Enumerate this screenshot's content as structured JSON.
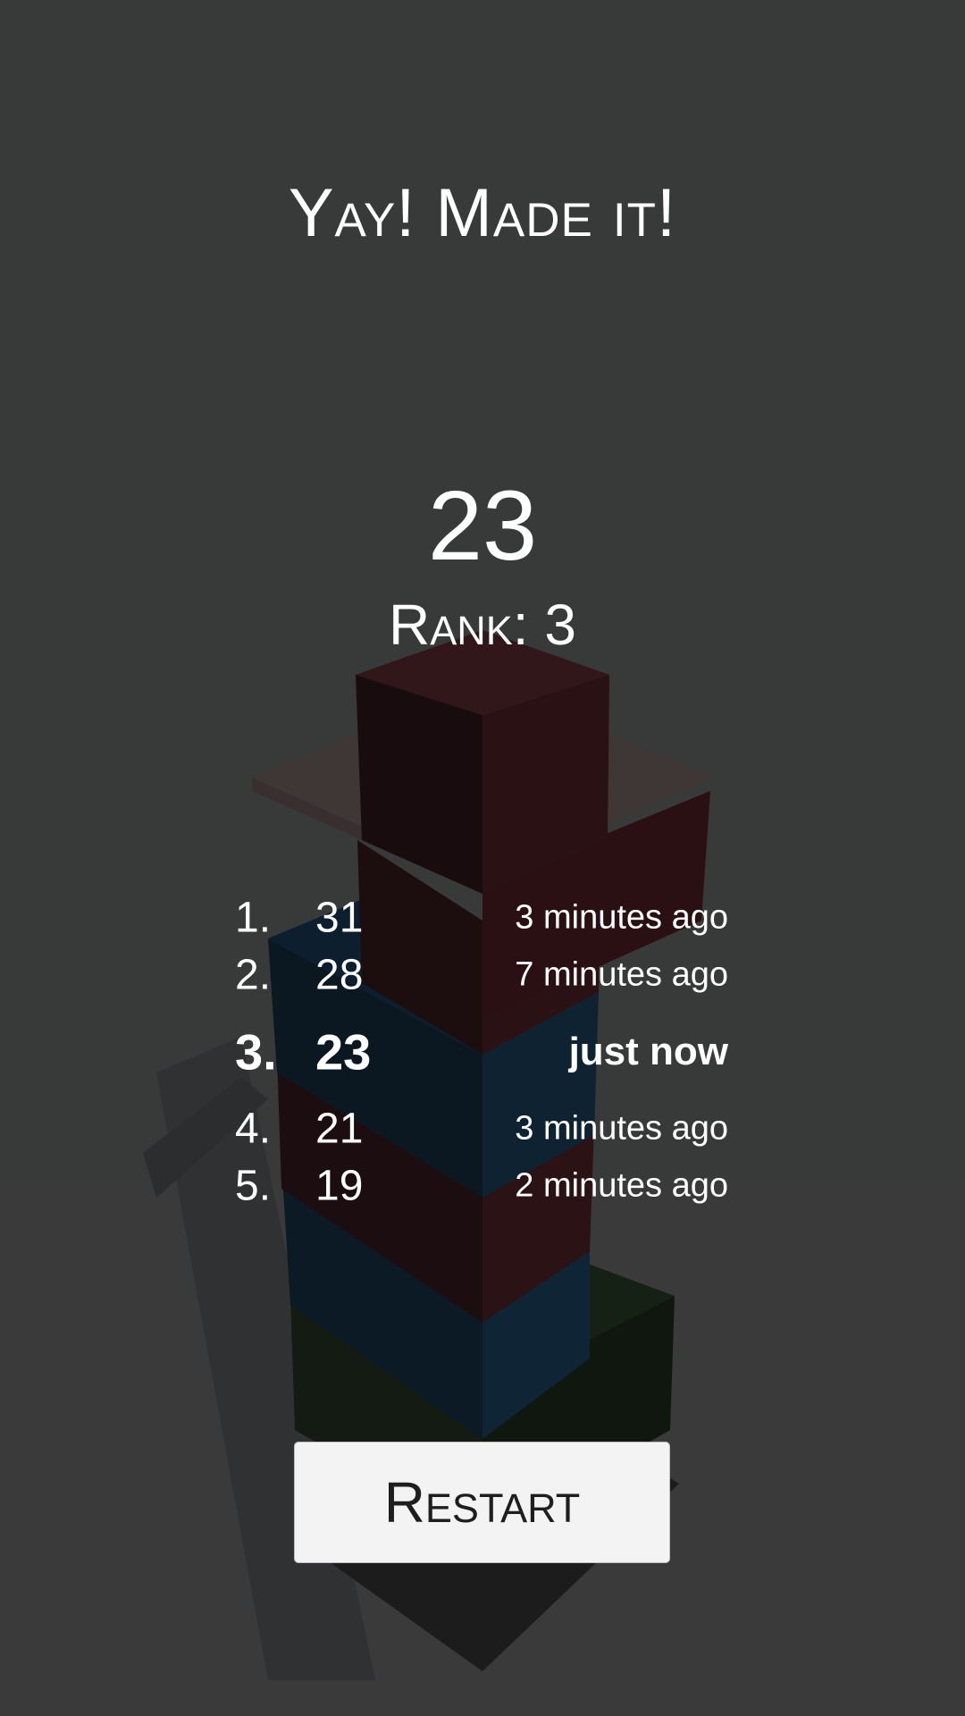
{
  "header": {
    "title": "Yay! Made it!"
  },
  "result": {
    "score": "23",
    "rank_label": "Rank:",
    "rank_value": "3"
  },
  "leaderboard": [
    {
      "rank": "1.",
      "score": "31",
      "time": "3 minutes ago",
      "current": false
    },
    {
      "rank": "2.",
      "score": "28",
      "time": "7 minutes ago",
      "current": false
    },
    {
      "rank": "3.",
      "score": "23",
      "time": "just now",
      "current": true
    },
    {
      "rank": "4.",
      "score": "21",
      "time": "3 minutes ago",
      "current": false
    },
    {
      "rank": "5.",
      "score": "19",
      "time": "2 minutes ago",
      "current": false
    }
  ],
  "actions": {
    "restart_label": "Restart"
  },
  "colors": {
    "background": "#3a3b3b",
    "block_red": "#2a1113",
    "block_blue": "#0e2233",
    "block_green": "#142014",
    "text": "#ffffff",
    "button_bg": "#f3f3f3",
    "button_text": "#1e1e1e"
  }
}
